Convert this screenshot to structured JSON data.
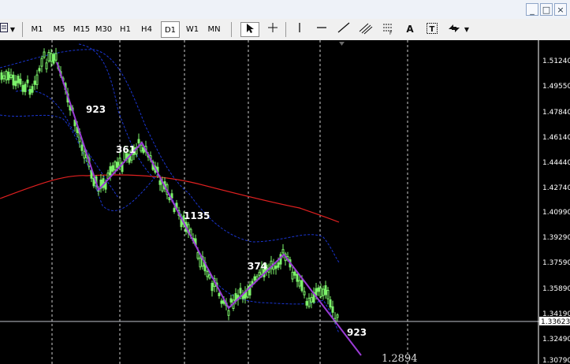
{
  "window_buttons": [
    "_",
    "□",
    "×"
  ],
  "toolbar": {
    "timeframes": [
      "M1",
      "M5",
      "M15",
      "M30",
      "H1",
      "H4",
      "D1",
      "W1",
      "MN"
    ],
    "active_timeframe": "D1",
    "text_tool_label": "A"
  },
  "price_axis": {
    "labels": [
      "1.51240",
      "1.49550",
      "1.47840",
      "1.46140",
      "1.44440",
      "1.42740",
      "1.40990",
      "1.39290",
      "1.37590",
      "1.35890",
      "1.34190",
      "1.32490",
      "1.30790"
    ],
    "current_price": "1.33623"
  },
  "chart_data": {
    "type": "line",
    "title": "",
    "ylim": [
      1.304,
      1.519
    ],
    "current_price": 1.33623,
    "target_price_annotation": "1.2894",
    "wave_labels": [
      "923",
      "361",
      "1135",
      "374",
      "923"
    ],
    "colors": {
      "background": "#000000",
      "candles": "#7cf26a",
      "wave_lines": "#9b3bd6",
      "moving_average": "#e02020",
      "envelope_bands": "#1a35d0",
      "period_separators": "#ffffff"
    }
  }
}
